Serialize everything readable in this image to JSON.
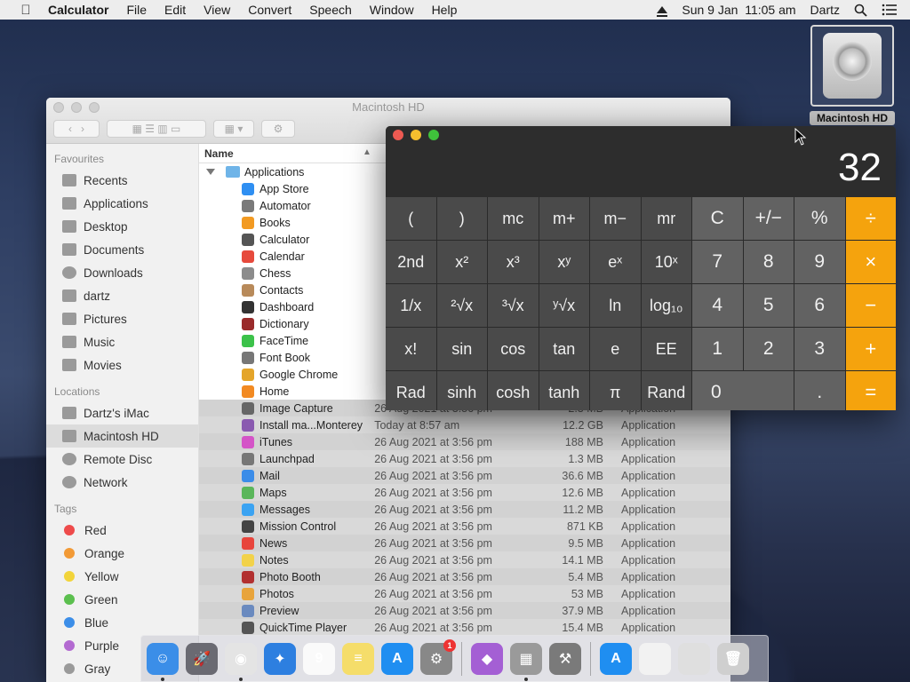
{
  "menubar": {
    "app_name": "Calculator",
    "menus": [
      "File",
      "Edit",
      "View",
      "Convert",
      "Speech",
      "Window",
      "Help"
    ],
    "datetime": "Sun 9 Jan  11:05 am",
    "user": "Dartz"
  },
  "desktop": {
    "hd_label": "Macintosh HD"
  },
  "finder": {
    "title": "Macintosh HD",
    "sidebar": {
      "favourites_label": "Favourites",
      "favourites": [
        "Recents",
        "Applications",
        "Desktop",
        "Documents",
        "Downloads",
        "dartz",
        "Pictures",
        "Music",
        "Movies"
      ],
      "locations_label": "Locations",
      "locations": [
        "Dartz's iMac",
        "Macintosh HD",
        "Remote Disc",
        "Network"
      ],
      "tags_label": "Tags",
      "tags": [
        {
          "name": "Red",
          "color": "#ee4b4b"
        },
        {
          "name": "Orange",
          "color": "#f29a36"
        },
        {
          "name": "Yellow",
          "color": "#f2d43a"
        },
        {
          "name": "Green",
          "color": "#5bbf4e"
        },
        {
          "name": "Blue",
          "color": "#3c8ee8"
        },
        {
          "name": "Purple",
          "color": "#b36ad1"
        },
        {
          "name": "Gray",
          "color": "#9a9a9a"
        }
      ]
    },
    "column_name": "Name",
    "folder": "Applications",
    "rows": [
      {
        "name": "App Store",
        "date": "",
        "size": "",
        "kind": "",
        "color": "#2f8ff2"
      },
      {
        "name": "Automator",
        "date": "",
        "size": "",
        "kind": "",
        "color": "#7a7a7a"
      },
      {
        "name": "Books",
        "date": "",
        "size": "",
        "kind": "",
        "color": "#f29a22"
      },
      {
        "name": "Calculator",
        "date": "",
        "size": "",
        "kind": "",
        "color": "#555"
      },
      {
        "name": "Calendar",
        "date": "",
        "size": "",
        "kind": "",
        "color": "#e64a3c"
      },
      {
        "name": "Chess",
        "date": "",
        "size": "",
        "kind": "",
        "color": "#8c8c8c"
      },
      {
        "name": "Contacts",
        "date": "",
        "size": "",
        "kind": "",
        "color": "#b88a5a"
      },
      {
        "name": "Dashboard",
        "date": "",
        "size": "",
        "kind": "",
        "color": "#333"
      },
      {
        "name": "Dictionary",
        "date": "",
        "size": "",
        "kind": "",
        "color": "#9a2b2b"
      },
      {
        "name": "FaceTime",
        "date": "",
        "size": "",
        "kind": "",
        "color": "#3cc24a"
      },
      {
        "name": "Font Book",
        "date": "",
        "size": "",
        "kind": "",
        "color": "#777"
      },
      {
        "name": "Google Chrome",
        "date": "",
        "size": "",
        "kind": "",
        "color": "#e4a52a"
      },
      {
        "name": "Home",
        "date": "",
        "size": "",
        "kind": "",
        "color": "#f28a22"
      },
      {
        "name": "Image Capture",
        "date": "26 Aug 2021 at 3:56 pm",
        "size": "2.3 MB",
        "kind": "Application",
        "color": "#666"
      },
      {
        "name": "Install ma...Monterey",
        "date": "Today at 8:57 am",
        "size": "12.2 GB",
        "kind": "Application",
        "color": "#8a5ab0"
      },
      {
        "name": "iTunes",
        "date": "26 Aug 2021 at 3:56 pm",
        "size": "188 MB",
        "kind": "Application",
        "color": "#d454c7"
      },
      {
        "name": "Launchpad",
        "date": "26 Aug 2021 at 3:56 pm",
        "size": "1.3 MB",
        "kind": "Application",
        "color": "#777"
      },
      {
        "name": "Mail",
        "date": "26 Aug 2021 at 3:56 pm",
        "size": "36.6 MB",
        "kind": "Application",
        "color": "#3b8ce8"
      },
      {
        "name": "Maps",
        "date": "26 Aug 2021 at 3:56 pm",
        "size": "12.6 MB",
        "kind": "Application",
        "color": "#5ab65a"
      },
      {
        "name": "Messages",
        "date": "26 Aug 2021 at 3:56 pm",
        "size": "11.2 MB",
        "kind": "Application",
        "color": "#3ba3f2"
      },
      {
        "name": "Mission Control",
        "date": "26 Aug 2021 at 3:56 pm",
        "size": "871 KB",
        "kind": "Application",
        "color": "#444"
      },
      {
        "name": "News",
        "date": "26 Aug 2021 at 3:56 pm",
        "size": "9.5 MB",
        "kind": "Application",
        "color": "#e8453c"
      },
      {
        "name": "Notes",
        "date": "26 Aug 2021 at 3:56 pm",
        "size": "14.1 MB",
        "kind": "Application",
        "color": "#f2d24a"
      },
      {
        "name": "Photo Booth",
        "date": "26 Aug 2021 at 3:56 pm",
        "size": "5.4 MB",
        "kind": "Application",
        "color": "#b23030"
      },
      {
        "name": "Photos",
        "date": "26 Aug 2021 at 3:56 pm",
        "size": "53 MB",
        "kind": "Application",
        "color": "#e8a43c"
      },
      {
        "name": "Preview",
        "date": "26 Aug 2021 at 3:56 pm",
        "size": "37.9 MB",
        "kind": "Application",
        "color": "#6a8abf"
      },
      {
        "name": "QuickTime Player",
        "date": "26 Aug 2021 at 3:56 pm",
        "size": "15.4 MB",
        "kind": "Application",
        "color": "#555"
      }
    ]
  },
  "calculator": {
    "display": "32",
    "keys": [
      {
        "label": "(",
        "type": "fn"
      },
      {
        "label": ")",
        "type": "fn"
      },
      {
        "label": "mc",
        "type": "fn"
      },
      {
        "label": "m+",
        "type": "fn"
      },
      {
        "label": "m−",
        "type": "fn"
      },
      {
        "label": "mr",
        "type": "fn"
      },
      {
        "label": "C",
        "type": "num"
      },
      {
        "label": "+/−",
        "type": "num"
      },
      {
        "label": "%",
        "type": "num"
      },
      {
        "label": "÷",
        "type": "op"
      },
      {
        "label": "2nd",
        "type": "fn"
      },
      {
        "label": "x²",
        "type": "fn"
      },
      {
        "label": "x³",
        "type": "fn"
      },
      {
        "label": "xʸ",
        "type": "fn"
      },
      {
        "label": "eˣ",
        "type": "fn"
      },
      {
        "label": "10ˣ",
        "type": "fn"
      },
      {
        "label": "7",
        "type": "num"
      },
      {
        "label": "8",
        "type": "num"
      },
      {
        "label": "9",
        "type": "num"
      },
      {
        "label": "×",
        "type": "op"
      },
      {
        "label": "1/x",
        "type": "fn"
      },
      {
        "label": "²√x",
        "type": "fn"
      },
      {
        "label": "³√x",
        "type": "fn"
      },
      {
        "label": "ʸ√x",
        "type": "fn"
      },
      {
        "label": "ln",
        "type": "fn"
      },
      {
        "label": "log₁₀",
        "type": "fn"
      },
      {
        "label": "4",
        "type": "num"
      },
      {
        "label": "5",
        "type": "num"
      },
      {
        "label": "6",
        "type": "num"
      },
      {
        "label": "−",
        "type": "op"
      },
      {
        "label": "x!",
        "type": "fn"
      },
      {
        "label": "sin",
        "type": "fn"
      },
      {
        "label": "cos",
        "type": "fn"
      },
      {
        "label": "tan",
        "type": "fn"
      },
      {
        "label": "e",
        "type": "fn"
      },
      {
        "label": "EE",
        "type": "fn"
      },
      {
        "label": "1",
        "type": "num"
      },
      {
        "label": "2",
        "type": "num"
      },
      {
        "label": "3",
        "type": "num"
      },
      {
        "label": "+",
        "type": "op"
      },
      {
        "label": "Rad",
        "type": "fn"
      },
      {
        "label": "sinh",
        "type": "fn"
      },
      {
        "label": "cosh",
        "type": "fn"
      },
      {
        "label": "tanh",
        "type": "fn"
      },
      {
        "label": "π",
        "type": "fn"
      },
      {
        "label": "Rand",
        "type": "fn"
      },
      {
        "label": "0",
        "type": "zero"
      },
      {
        "label": ".",
        "type": "num"
      },
      {
        "label": "=",
        "type": "op"
      }
    ]
  },
  "dock": {
    "items": [
      {
        "name": "finder",
        "color": "#3b8ee8",
        "glyph": "☺",
        "running": true
      },
      {
        "name": "launchpad",
        "color": "#6a6a72",
        "glyph": "🚀",
        "running": false
      },
      {
        "name": "chrome",
        "color": "#e4e4e4",
        "glyph": "◉",
        "running": true
      },
      {
        "name": "safari",
        "color": "#2d7fe0",
        "glyph": "✦",
        "running": false
      },
      {
        "name": "calendar",
        "color": "#fafafa",
        "glyph": "9",
        "running": false
      },
      {
        "name": "notes",
        "color": "#f5dd6a",
        "glyph": "≡",
        "running": false
      },
      {
        "name": "app-store",
        "color": "#1f8ef1",
        "glyph": "A",
        "running": false
      },
      {
        "name": "system-preferences",
        "color": "#888",
        "glyph": "⚙",
        "running": false,
        "badge": "1"
      },
      {
        "name": "sep",
        "color": "",
        "glyph": "",
        "running": false
      },
      {
        "name": "installer",
        "color": "#a45fd4",
        "glyph": "◆",
        "running": false
      },
      {
        "name": "calculator",
        "color": "#9a9a9a",
        "glyph": "▦",
        "running": true
      },
      {
        "name": "automator",
        "color": "#7a7a7a",
        "glyph": "⚒",
        "running": false
      },
      {
        "name": "sep",
        "color": "",
        "glyph": "",
        "running": false
      },
      {
        "name": "app-store-2",
        "color": "#1f8ef1",
        "glyph": "A",
        "running": false
      },
      {
        "name": "document",
        "color": "#f2f2f2",
        "glyph": "",
        "running": false
      },
      {
        "name": "downloads-stack",
        "color": "#dfdfdf",
        "glyph": "",
        "running": false
      },
      {
        "name": "trash",
        "color": "#cfcfcf",
        "glyph": "🗑",
        "running": false
      }
    ]
  }
}
